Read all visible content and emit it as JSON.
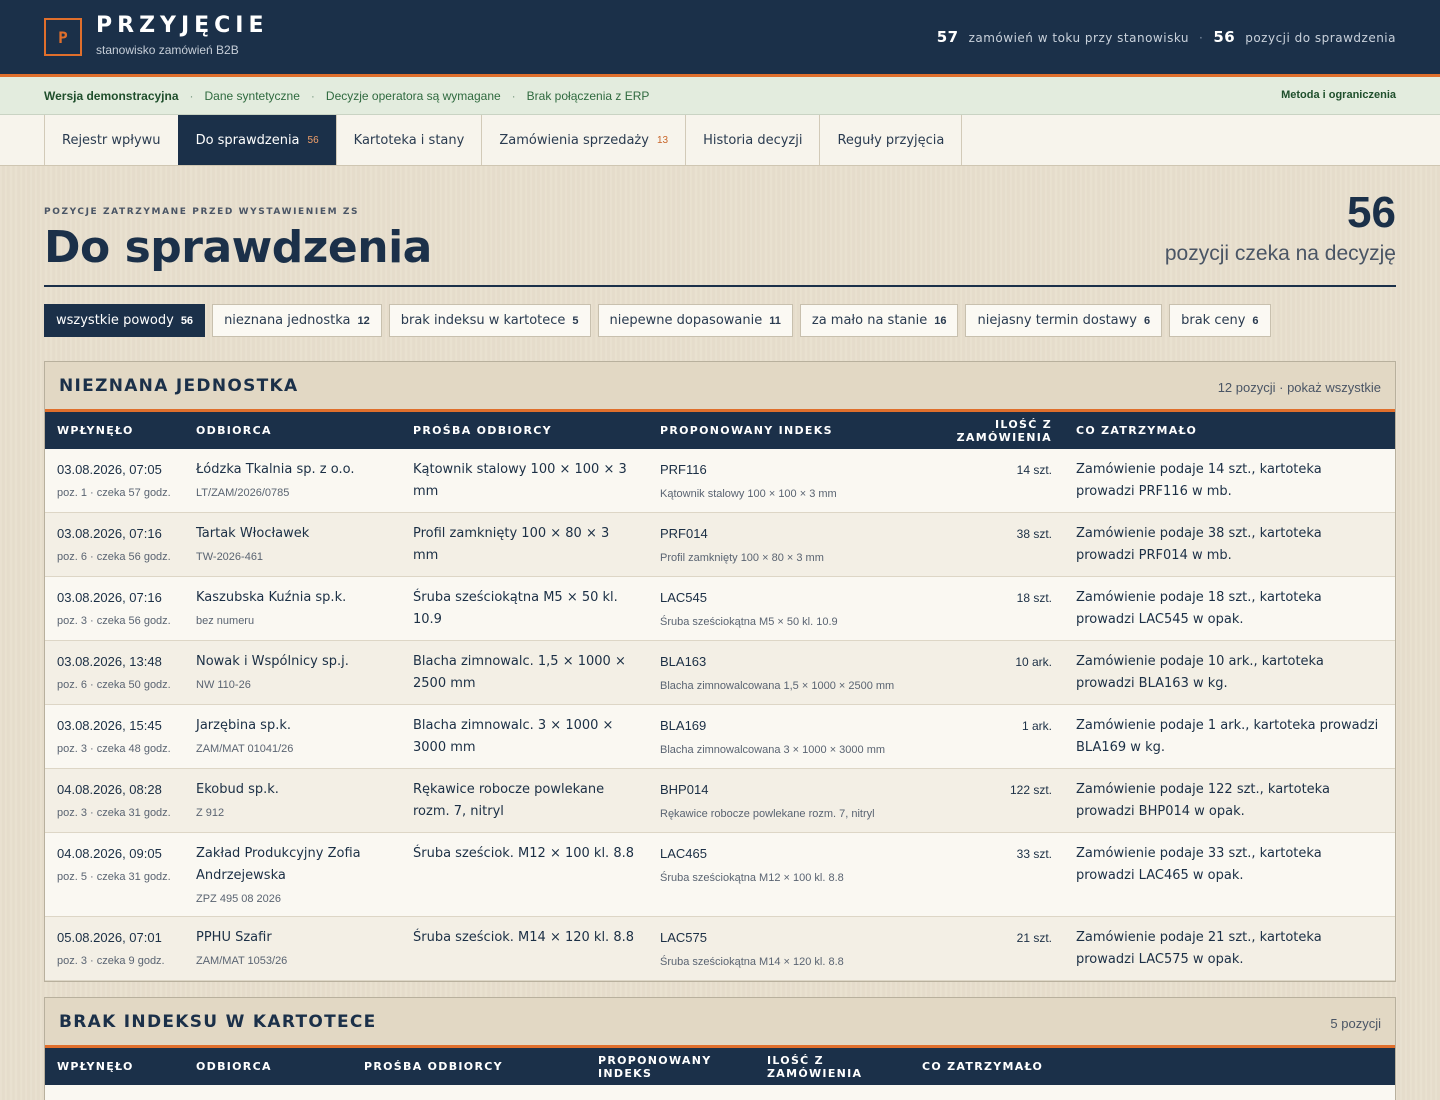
{
  "app": {
    "logo_letter": "P",
    "title": "PRZYJĘCIE",
    "subtitle": "stanowisko zamówień B2B",
    "stats": [
      {
        "value": "57",
        "label": "zamówień w toku przy stanowisku"
      },
      {
        "value": "56",
        "label": "pozycji do sprawdzenia"
      }
    ],
    "stat_separator": "·"
  },
  "infostrip": {
    "items": [
      "Wersja demonstracyjna",
      "Dane syntetyczne",
      "Decyzje operatora są wymagane",
      "Brak połączenia z ERP"
    ],
    "separator": "·",
    "method_link": "Metoda i ograniczenia"
  },
  "nav": {
    "tabs": [
      {
        "label": "Rejestr wpływu",
        "count": ""
      },
      {
        "label": "Do sprawdzenia",
        "count": "56",
        "active": true
      },
      {
        "label": "Kartoteka i stany",
        "count": ""
      },
      {
        "label": "Zamówienia sprzedaży",
        "count": "13"
      },
      {
        "label": "Historia decyzji",
        "count": ""
      },
      {
        "label": "Reguły przyjęcia",
        "count": ""
      }
    ]
  },
  "page": {
    "eyebrow": "POZYCJE ZATRZYMANE PRZED WYSTAWIENIEM ZS",
    "title": "Do sprawdzenia",
    "count": "56",
    "count_label": "pozycji czeka na decyzję"
  },
  "filters": [
    {
      "label": "wszystkie powody",
      "count": "56",
      "active": true
    },
    {
      "label": "nieznana jednostka",
      "count": "12"
    },
    {
      "label": "brak indeksu w kartotece",
      "count": "5"
    },
    {
      "label": "niepewne dopasowanie",
      "count": "11"
    },
    {
      "label": "za mało na stanie",
      "count": "16"
    },
    {
      "label": "niejasny termin dostawy",
      "count": "6"
    },
    {
      "label": "brak ceny",
      "count": "6"
    }
  ],
  "sections": [
    {
      "title": "NIEZNANA JEDNOSTKA",
      "meta_count": "12 pozycji",
      "meta_sep": " · ",
      "meta_link": "pokaż wszystkie",
      "columns": [
        "WPŁYNĘŁO",
        "ODBIORCA",
        "PROŚBA ODBIORCY",
        "PROPONOWANY INDEKS",
        "ILOŚĆ Z ZAMÓWIENIA",
        "CO ZATRZYMAŁO"
      ],
      "rows": [
        {
          "date": "03.08.2026, 07:05",
          "wait": "poz. 1 · czeka 57 godz.",
          "customer": "Łódzka Tkalnia sp. z o.o.",
          "ref": "LT/ZAM/2026/0785",
          "request": "Kątownik stalowy 100 × 100 × 3 mm",
          "index_code": "PRF116",
          "index_name": "Kątownik stalowy 100 × 100 × 3 mm",
          "qty": "14 szt.",
          "reason": "Zamówienie podaje 14 szt., kartoteka prowadzi PRF116 w mb."
        },
        {
          "date": "03.08.2026, 07:16",
          "wait": "poz. 6 · czeka 56 godz.",
          "customer": "Tartak Włocławek",
          "ref": "TW-2026-461",
          "request": "Profil zamknięty 100 × 80 × 3 mm",
          "index_code": "PRF014",
          "index_name": "Profil zamknięty 100 × 80 × 3 mm",
          "qty": "38 szt.",
          "reason": "Zamówienie podaje 38 szt., kartoteka prowadzi PRF014 w mb."
        },
        {
          "date": "03.08.2026, 07:16",
          "wait": "poz. 3 · czeka 56 godz.",
          "customer": "Kaszubska Kuźnia sp.k.",
          "ref": "bez numeru",
          "request": "Śruba sześciokątna M5 × 50 kl. 10.9",
          "index_code": "LAC545",
          "index_name": "Śruba sześciokątna M5 × 50 kl. 10.9",
          "qty": "18 szt.",
          "reason": "Zamówienie podaje 18 szt., kartoteka prowadzi LAC545 w opak."
        },
        {
          "date": "03.08.2026, 13:48",
          "wait": "poz. 6 · czeka 50 godz.",
          "customer": "Nowak i Wspólnicy sp.j.",
          "ref": "NW 110-26",
          "request": "Blacha zimnowalc. 1,5 × 1000 × 2500 mm",
          "index_code": "BLA163",
          "index_name": "Blacha zimnowalcowana 1,5 × 1000 × 2500 mm",
          "qty": "10 ark.",
          "reason": "Zamówienie podaje 10 ark., kartoteka prowadzi BLA163 w kg."
        },
        {
          "date": "03.08.2026, 15:45",
          "wait": "poz. 3 · czeka 48 godz.",
          "customer": "Jarzębina sp.k.",
          "ref": "ZAM/MAT 01041/26",
          "request": "Blacha zimnowalc. 3 × 1000 × 3000 mm",
          "index_code": "BLA169",
          "index_name": "Blacha zimnowalcowana 3 × 1000 × 3000 mm",
          "qty": "1 ark.",
          "reason": "Zamówienie podaje 1 ark., kartoteka prowadzi BLA169 w kg."
        },
        {
          "date": "04.08.2026, 08:28",
          "wait": "poz. 3 · czeka 31 godz.",
          "customer": "Ekobud sp.k.",
          "ref": "Z 912",
          "request": "Rękawice robocze powlekane rozm. 7, nitryl",
          "index_code": "BHP014",
          "index_name": "Rękawice robocze powlekane rozm. 7, nitryl",
          "qty": "122 szt.",
          "reason": "Zamówienie podaje 122 szt., kartoteka prowadzi BHP014 w opak."
        },
        {
          "date": "04.08.2026, 09:05",
          "wait": "poz. 5 · czeka 31 godz.",
          "customer": "Zakład Produkcyjny Zofia Andrzejewska",
          "ref": "ZPZ 495 08 2026",
          "request": "Śruba sześciok. M12 × 100 kl. 8.8",
          "index_code": "LAC465",
          "index_name": "Śruba sześciokątna M12 × 100 kl. 8.8",
          "qty": "33 szt.",
          "reason": "Zamówienie podaje 33 szt., kartoteka prowadzi LAC465 w opak."
        },
        {
          "date": "05.08.2026, 07:01",
          "wait": "poz. 3 · czeka 9 godz.",
          "customer": "PPHU Szafir",
          "ref": "ZAM/MAT 1053/26",
          "request": "Śruba sześciok. M14 × 120 kl. 8.8",
          "index_code": "LAC575",
          "index_name": "Śruba sześciokątna M14 × 120 kl. 8.8",
          "qty": "21 szt.",
          "reason": "Zamówienie podaje 21 szt., kartoteka prowadzi LAC575 w opak."
        }
      ]
    },
    {
      "title": "BRAK INDEKSU W KARTOTECE",
      "meta_count": "5 pozycji",
      "columns": [
        "WPŁYNĘŁO",
        "ODBIORCA",
        "PROŚBA ODBIORCY",
        "PROPONOWANY INDEKS",
        "ILOŚĆ Z ZAMÓWIENIA",
        "CO ZATRZYMAŁO"
      ]
    }
  ]
}
